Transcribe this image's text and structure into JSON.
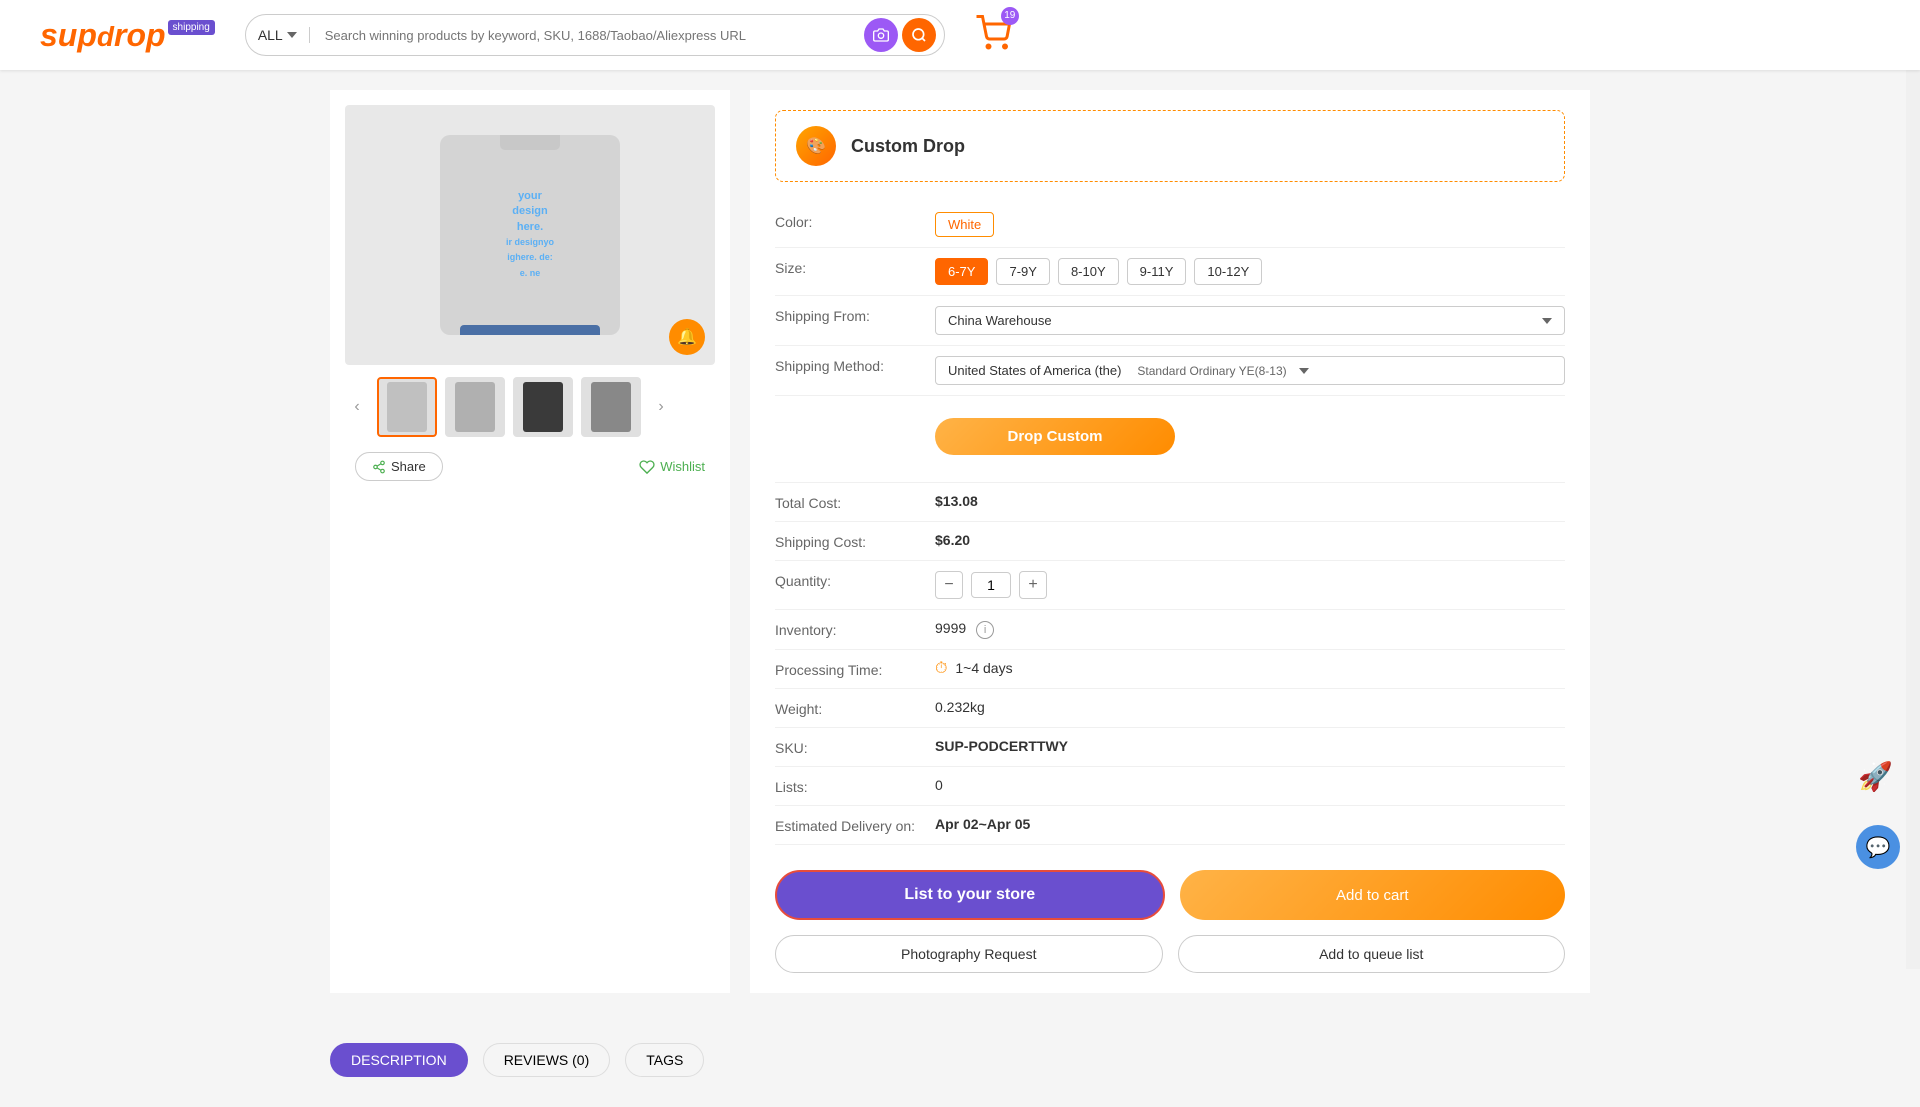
{
  "header": {
    "logo_text": "supdrop",
    "logo_shipping": "shipping",
    "search_category": "ALL",
    "search_placeholder": "Search winning products by keyword, SKU, 1688/Taobao/Aliexpress URL",
    "cart_count": "19"
  },
  "product": {
    "main_image_text": "your\ndesign\nhere.",
    "color_selected": "White",
    "size_options": [
      "6-7Y",
      "7-9Y",
      "8-10Y",
      "9-11Y",
      "10-12Y"
    ],
    "size_selected": "6-7Y",
    "shipping_from": "China Warehouse",
    "shipping_method_country": "United States of America (the)",
    "shipping_method_type": "Standard Ordinary YE(8-13)",
    "drop_custom_label": "Drop Custom",
    "total_cost": "$13.08",
    "shipping_cost": "$6.20",
    "quantity": "1",
    "inventory": "9999",
    "processing_time": "1~4 days",
    "weight": "0.232kg",
    "sku": "SUP-PODCERTTWY",
    "lists": "0",
    "estimated_delivery": "Apr 02~Apr 05",
    "custom_drop_title": "Custom Drop",
    "labels": {
      "color": "Color:",
      "size": "Size:",
      "shipping_from": "Shipping From:",
      "shipping_method": "Shipping Method:",
      "total_cost": "Total Cost:",
      "shipping_cost": "Shipping Cost:",
      "quantity": "Quantity:",
      "inventory": "Inventory:",
      "processing_time": "Processing Time:",
      "weight": "Weight:",
      "sku": "SKU:",
      "lists": "Lists:",
      "estimated_delivery": "Estimated Delivery on:"
    }
  },
  "buttons": {
    "share": "Share",
    "wishlist": "Wishlist",
    "list_to_store": "List to your store",
    "add_to_cart": "Add to cart",
    "photo_request": "Photography Request",
    "add_to_queue": "Add to queue list"
  },
  "tabs": {
    "items": [
      {
        "label": "DESCRIPTION",
        "active": true
      },
      {
        "label": "REVIEWS (0)",
        "active": false
      },
      {
        "label": "TAGS",
        "active": false
      }
    ]
  }
}
